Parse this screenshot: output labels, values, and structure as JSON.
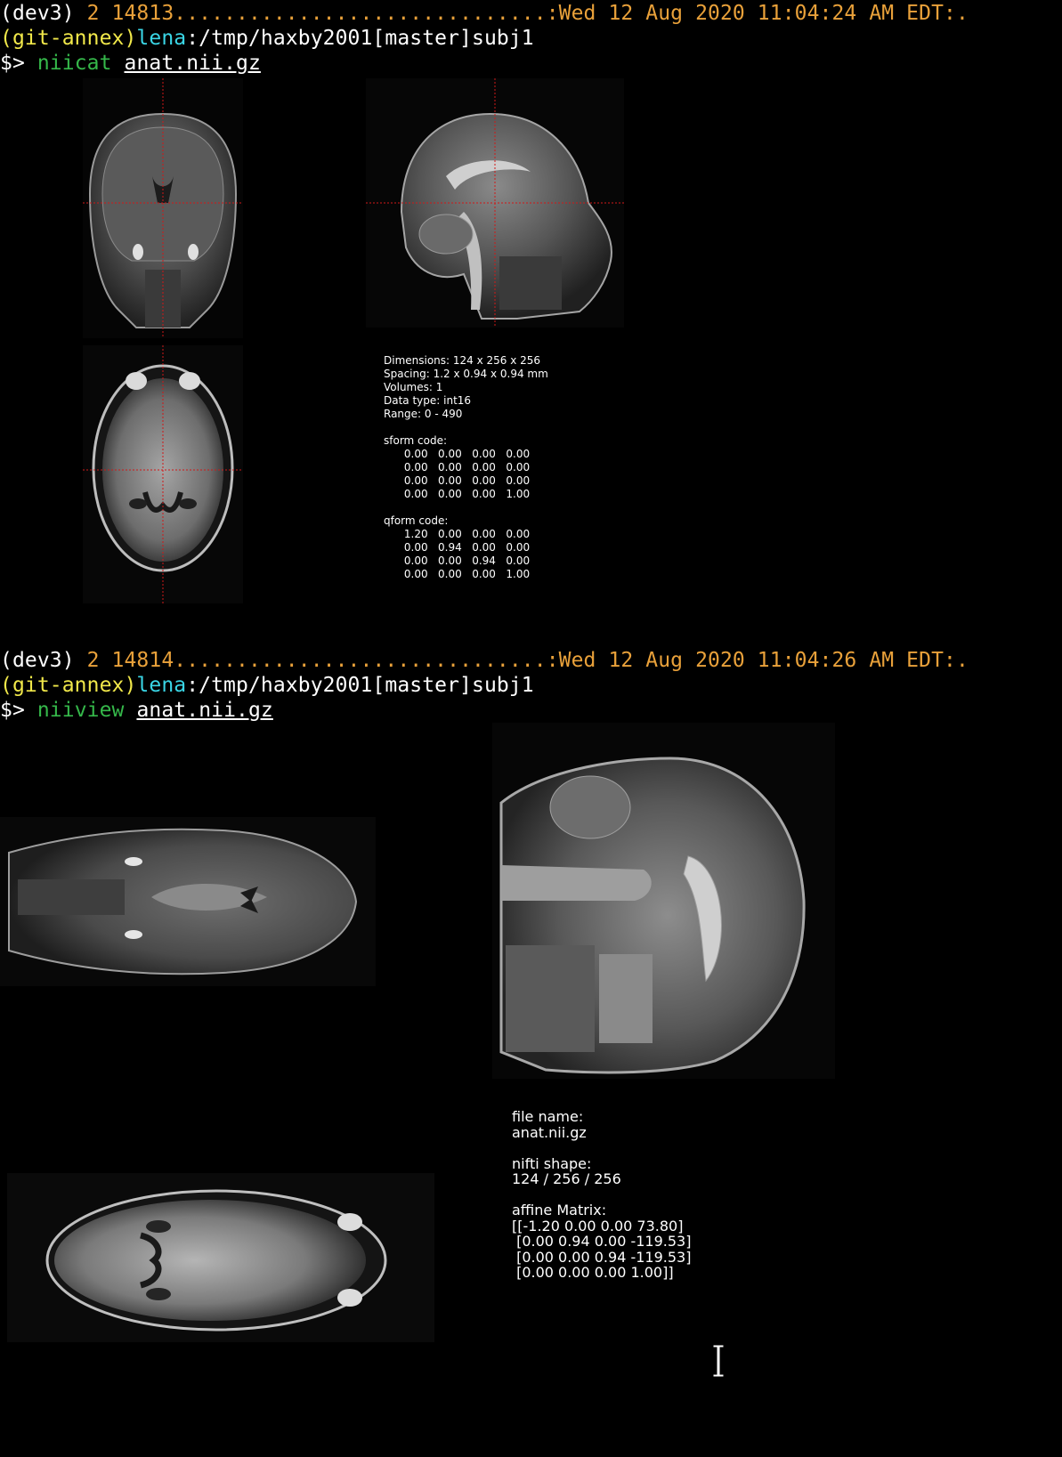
{
  "session1": {
    "env": "(dev3)",
    "counter": "2 14813",
    "dots": "..............................",
    "timestamp": ":Wed 12 Aug 2020 11:04:24 AM EDT:.",
    "repo": "(git-annex)",
    "user": "lena",
    "path": ":/tmp/haxby2001[master]subj1",
    "prompt": "$>",
    "command": "niicat",
    "arg": "anat.nii.gz",
    "info": "Dimensions: 124 x 256 x 256\nSpacing: 1.2 x 0.94 x 0.94 mm\nVolumes: 1\nData type: int16\nRange: 0 - 490\n\nsform code:\n      0.00   0.00   0.00   0.00\n      0.00   0.00   0.00   0.00\n      0.00   0.00   0.00   0.00\n      0.00   0.00   0.00   1.00\n\nqform code:\n      1.20   0.00   0.00   0.00\n      0.00   0.94   0.00   0.00\n      0.00   0.00   0.94   0.00\n      0.00   0.00   0.00   1.00"
  },
  "session2": {
    "env": "(dev3)",
    "counter": "2 14814",
    "dots": "..............................",
    "timestamp": ":Wed 12 Aug 2020 11:04:26 AM EDT:.",
    "repo": "(git-annex)",
    "user": "lena",
    "path": ":/tmp/haxby2001[master]subj1",
    "prompt": "$>",
    "command": "niiview",
    "arg": "anat.nii.gz",
    "info": "file name:\nanat.nii.gz\n\nnifti shape:\n124 / 256 / 256\n\naffine Matrix:\n[[-1.20 0.00 0.00 73.80]\n [0.00 0.94 0.00 -119.53]\n [0.00 0.00 0.94 -119.53]\n [0.00 0.00 0.00 1.00]]"
  },
  "colors": {
    "background": "#000000",
    "orange": "#e9a13a",
    "yellow": "#f1e84a",
    "cyan": "#3ad6e6",
    "green": "#35b84a",
    "crosshair": "#d01818"
  },
  "icons": {
    "cursor": "text-cursor-icon"
  }
}
